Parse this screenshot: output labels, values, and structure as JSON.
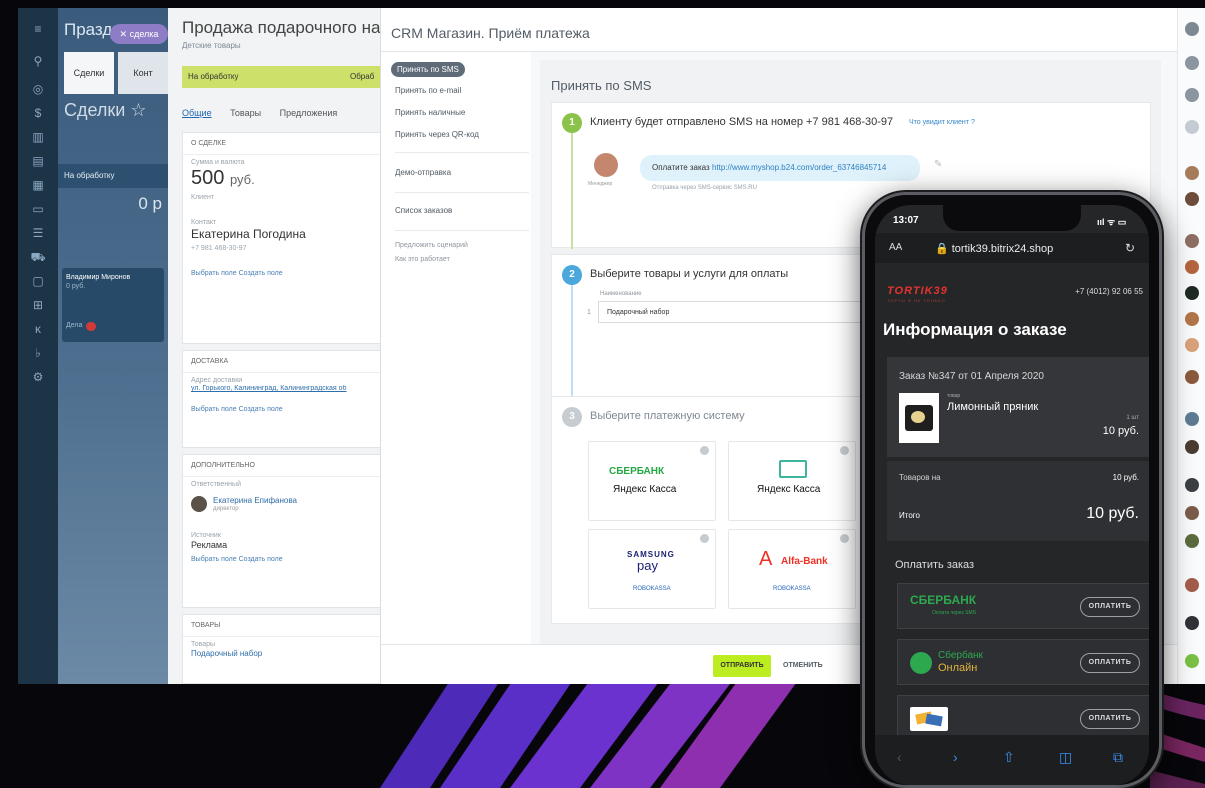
{
  "left_panel": {
    "title": "Праздн",
    "pill": "✕ сделка",
    "tab1": "Сделки",
    "tab2": "Конт",
    "subtitle": "Сделки ☆",
    "column": "На обработку",
    "amount": "0 р",
    "card_name": "Владимир Миронов",
    "card_sum": "0 руб.",
    "badge": "Дела"
  },
  "deal": {
    "title": "Продажа подарочного на",
    "subtitle": "Детские товары",
    "stage": "На обработку",
    "stage2": "Обраб",
    "tabs": [
      "Общие",
      "Товары",
      "Предложения"
    ],
    "about_header": "о сделке",
    "sum_label": "Сумма и валюта",
    "sum": "500",
    "currency": "руб.",
    "client_label": "Клиент",
    "contact_label": "Контакт",
    "contact_name": "Екатерина Погодина",
    "contact_phone": "+7 981 468-30-97",
    "links": "Выбрать поле   Создать поле",
    "delivery_header": "доставка",
    "address_label": "Адрес доставки",
    "address": "ул. Горького, Калининград, Калининградская об",
    "extra_header": "дополнительно",
    "responsible_label": "Ответственный",
    "responsible": "Екатерина Епифанова",
    "responsible_role": "директор",
    "source_label": "Источник",
    "source": "Реклама",
    "goods_header": "товары",
    "goods_label": "Товары",
    "goods": "Подарочный набор"
  },
  "crm": {
    "title": "CRM Магазин. Приём платежа",
    "menu": [
      "Принять по SMS",
      "Принять по e-mail",
      "Принять наличные",
      "Принять через QR-код"
    ],
    "demo": "Демо-отправка",
    "orders": "Список заказов",
    "suggest": "Предложить сценарий",
    "how": "Как это работает",
    "main_title": "Принять по SMS",
    "step1": "1",
    "step1_text": "Клиенту будет отправлено SMS на номер +7 981 468-30-97",
    "step1_hint": "Что увидит клиент ?",
    "sms_prefix": "Оплатите заказ",
    "sms_link": "http://www.myshop.b24.com/order_63746845714",
    "sms_via": "Отправка через SMS-сервис SMS.RU",
    "avatar_label": "Менеджер",
    "step2": "2",
    "step2_text": "Выберите товары и услуги для оплаты",
    "col_name": "Наименование",
    "row_num": "1",
    "row_value": "Подарочный набор",
    "step3": "3",
    "step3_text": "Выберите платежную систему",
    "pay_sber": "СБЕРБАНК",
    "pay_yandex": "Яндекс Касса",
    "pay_samsung1": "SAMSUNG",
    "pay_samsung2": "pay",
    "pay_robokassa": "ROBOKASSA",
    "pay_alfa": "Alfa-Bank",
    "send": "ОТПРАВИТЬ",
    "cancel": "ОТМЕНИТЬ"
  },
  "phone": {
    "time": "13:07",
    "signal": "ııl ᯤ ▭",
    "aa": "AA",
    "url": "🔒 tortik39.bitrix24.shop",
    "logo": "TORTIK39",
    "logo_sub": "ТОРТЫ И НЕ ТОЛЬКО",
    "tel": "+7 (4012) 92 06 55",
    "title": "Информация о заказе",
    "order": "Заказ №347 от 01 Апреля 2020",
    "product_type": "товар",
    "product": "Лимонный пряник",
    "qty": "1 шт",
    "price": "10 руб.",
    "goods_on": "Товаров на",
    "goods_sum": "10 руб.",
    "total_label": "Итого",
    "total": "10 руб.",
    "pay_title": "Оплатить заказ",
    "sber": "СБЕРБАНК",
    "sber_sub": "Оплата через SMS",
    "sber_online1": "Сбербанк",
    "sber_online2": "Онлайн",
    "pay_btn": "ОПЛАТИТЬ"
  }
}
